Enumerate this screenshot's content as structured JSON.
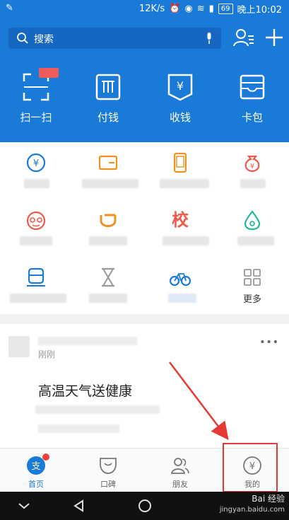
{
  "status_bar": {
    "speed": "12K/s",
    "battery": "69",
    "time": "晚上10:02"
  },
  "search": {
    "placeholder": "搜索"
  },
  "quick_actions": [
    {
      "label": "扫一扫",
      "icon": "scan-icon"
    },
    {
      "label": "付钱",
      "icon": "pay-icon"
    },
    {
      "label": "收钱",
      "icon": "receive-money-icon"
    },
    {
      "label": "卡包",
      "icon": "card-wallet-icon"
    }
  ],
  "app_grid": {
    "row3_label_more": "更多",
    "school_glyph": "校"
  },
  "feed": {
    "time": "刚刚",
    "headline": "高温天气送健康",
    "more_glyph": "•••"
  },
  "tabs": [
    {
      "label": "首页",
      "icon": "home-icon"
    },
    {
      "label": "口碑",
      "icon": "koubei-icon"
    },
    {
      "label": "朋友",
      "icon": "friends-icon"
    },
    {
      "label": "我的",
      "icon": "my-icon"
    }
  ],
  "watermark": {
    "brand": "Bai 经验",
    "site": "jingyan.baidu.com"
  },
  "colors": {
    "brand_blue": "#1a7ad8",
    "annotation_red": "#e53935",
    "badge_red": "#f0413a"
  }
}
